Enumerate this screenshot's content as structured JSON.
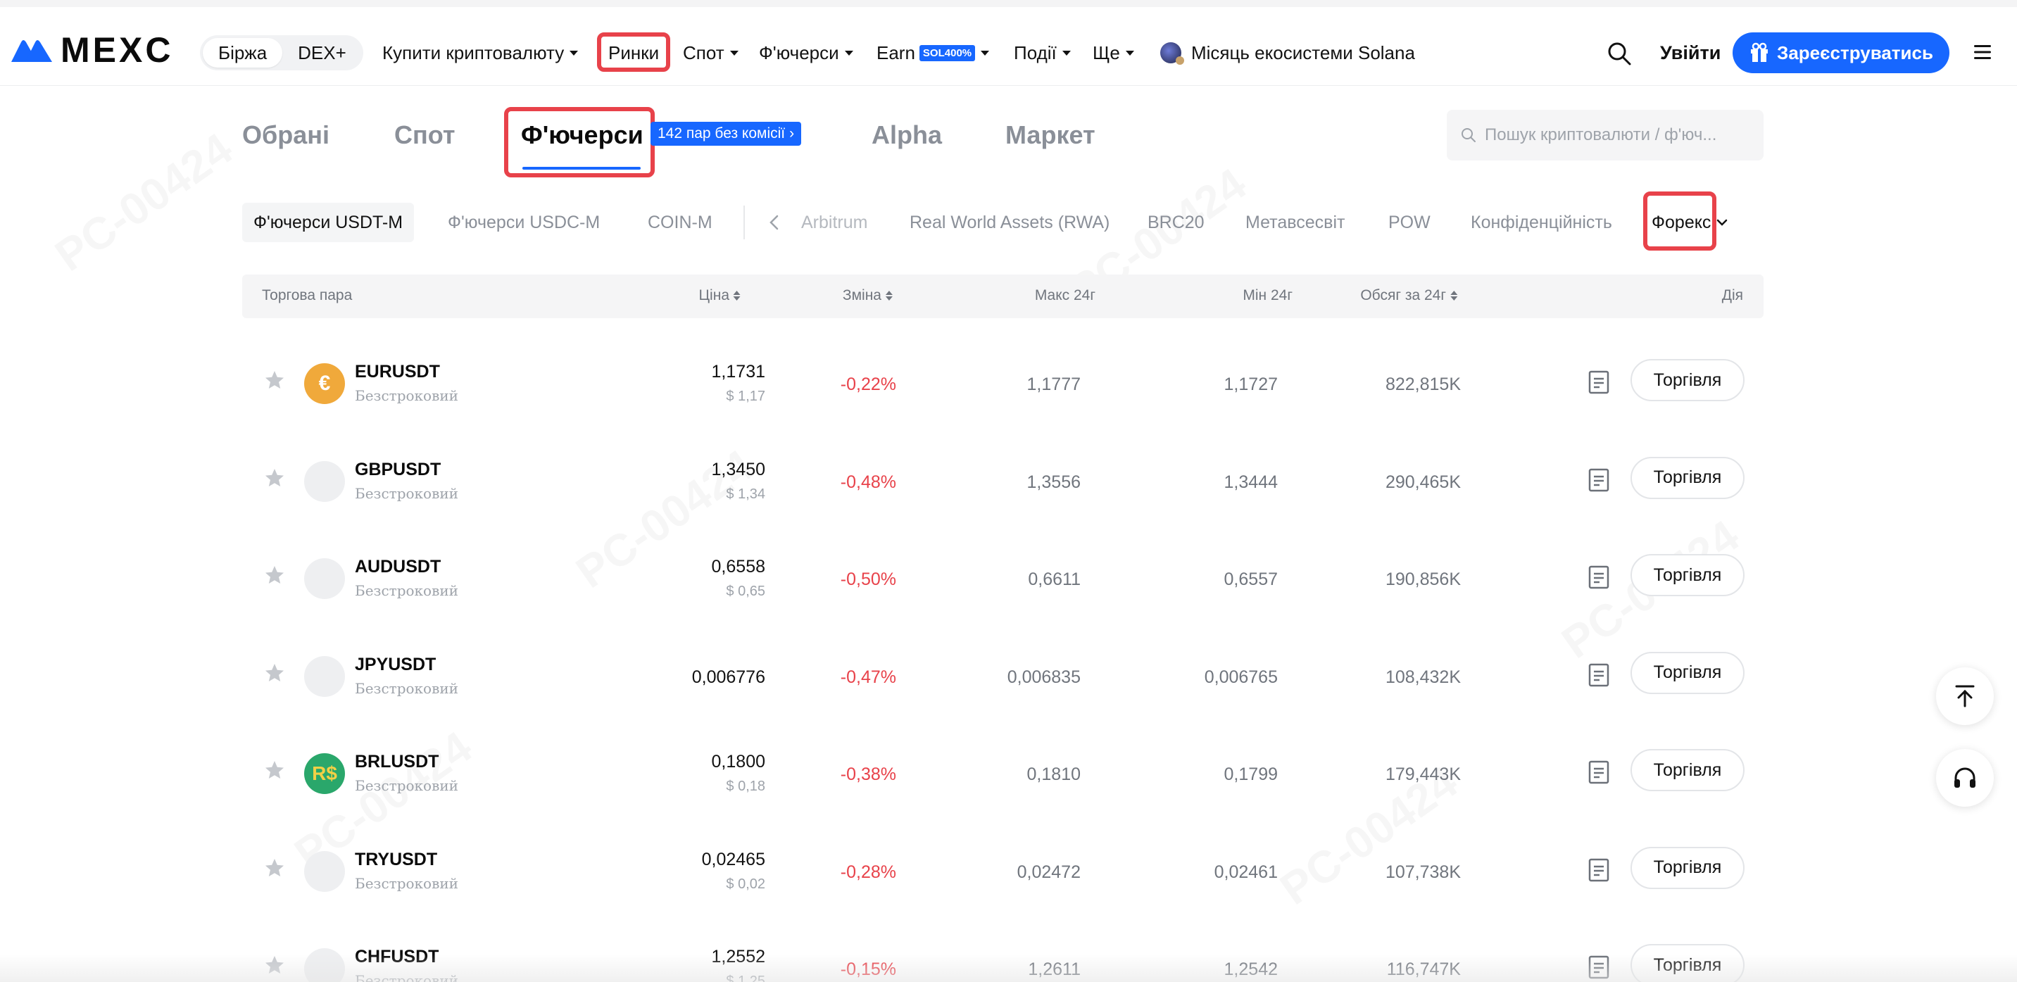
{
  "brand": {
    "name": "MEXC",
    "color": "#1767ff"
  },
  "header": {
    "segment": [
      "Біржа",
      "DEX+"
    ],
    "nav": [
      {
        "label": "Купити криптовалюту",
        "dropdown": true
      },
      {
        "label": "Ринки",
        "dropdown": false
      },
      {
        "label": "Спот",
        "dropdown": true
      },
      {
        "label": "Ф'ючерси",
        "dropdown": true
      },
      {
        "label": "Earn",
        "badge": "SOL400%",
        "dropdown": true
      },
      {
        "label": "Події",
        "dropdown": true
      },
      {
        "label": "Ще",
        "dropdown": true
      }
    ],
    "promo_link": "Місяць екосистеми Solana",
    "login": "Увійти",
    "register": "Зареєструватись"
  },
  "market_tabs": {
    "items": [
      "Обрані",
      "Спот",
      "Ф'ючерси",
      "Alpha",
      "Маркет"
    ],
    "active": "Ф'ючерси",
    "promo": "142 пар без комісії",
    "search_placeholder": "Пошук криптовалюти / ф'юч..."
  },
  "subcategories": {
    "items": [
      "Ф'ючерси USDT-M",
      "Ф'ючерси USDC-M",
      "COIN-M",
      "Arbitrum",
      "Real World Assets (RWA)",
      "BRC20",
      "Метавсесвіт",
      "POW",
      "Конфіденційність"
    ],
    "active": "Ф'ючерси USDT-M",
    "dropdown": "Форекс"
  },
  "table": {
    "headers": {
      "pair": "Торгова пара",
      "price": "Ціна",
      "change": "Зміна",
      "high": "Макс 24г",
      "low": "Мін 24г",
      "volume": "Обсяг за 24г",
      "action": "Дія"
    },
    "subtitle": "Безстроковий",
    "trade_label": "Торгівля",
    "rows": [
      {
        "symbol": "EURUSDT",
        "icon": "euro-coin-icon",
        "price": "1,1731",
        "usd": "$ 1,17",
        "change": "-0,22%",
        "high": "1,1777",
        "low": "1,1727",
        "volume": "822,815K"
      },
      {
        "symbol": "GBPUSDT",
        "icon": "placeholder-coin-icon",
        "price": "1,3450",
        "usd": "$ 1,34",
        "change": "-0,48%",
        "high": "1,3556",
        "low": "1,3444",
        "volume": "290,465K"
      },
      {
        "symbol": "AUDUSDT",
        "icon": "placeholder-coin-icon",
        "price": "0,6558",
        "usd": "$ 0,65",
        "change": "-0,50%",
        "high": "0,6611",
        "low": "0,6557",
        "volume": "190,856K"
      },
      {
        "symbol": "JPYUSDT",
        "icon": "placeholder-coin-icon",
        "price": "0,006776",
        "usd": "",
        "change": "-0,47%",
        "high": "0,006835",
        "low": "0,006765",
        "volume": "108,432K"
      },
      {
        "symbol": "BRLUSDT",
        "icon": "real-coin-icon",
        "price": "0,1800",
        "usd": "$ 0,18",
        "change": "-0,38%",
        "high": "0,1810",
        "low": "0,1799",
        "volume": "179,443K"
      },
      {
        "symbol": "TRYUSDT",
        "icon": "placeholder-coin-icon",
        "price": "0,02465",
        "usd": "$ 0,02",
        "change": "-0,28%",
        "high": "0,02472",
        "low": "0,02461",
        "volume": "107,738K"
      },
      {
        "symbol": "CHFUSDT",
        "icon": "placeholder-coin-icon",
        "price": "1,2552",
        "usd": "$ 1,25",
        "change": "-0,15%",
        "high": "1,2611",
        "low": "1,2542",
        "volume": "116,747K"
      }
    ]
  },
  "colors": {
    "accent": "#1767ff",
    "negative": "#e8424a",
    "highlight": "#e8424a"
  }
}
